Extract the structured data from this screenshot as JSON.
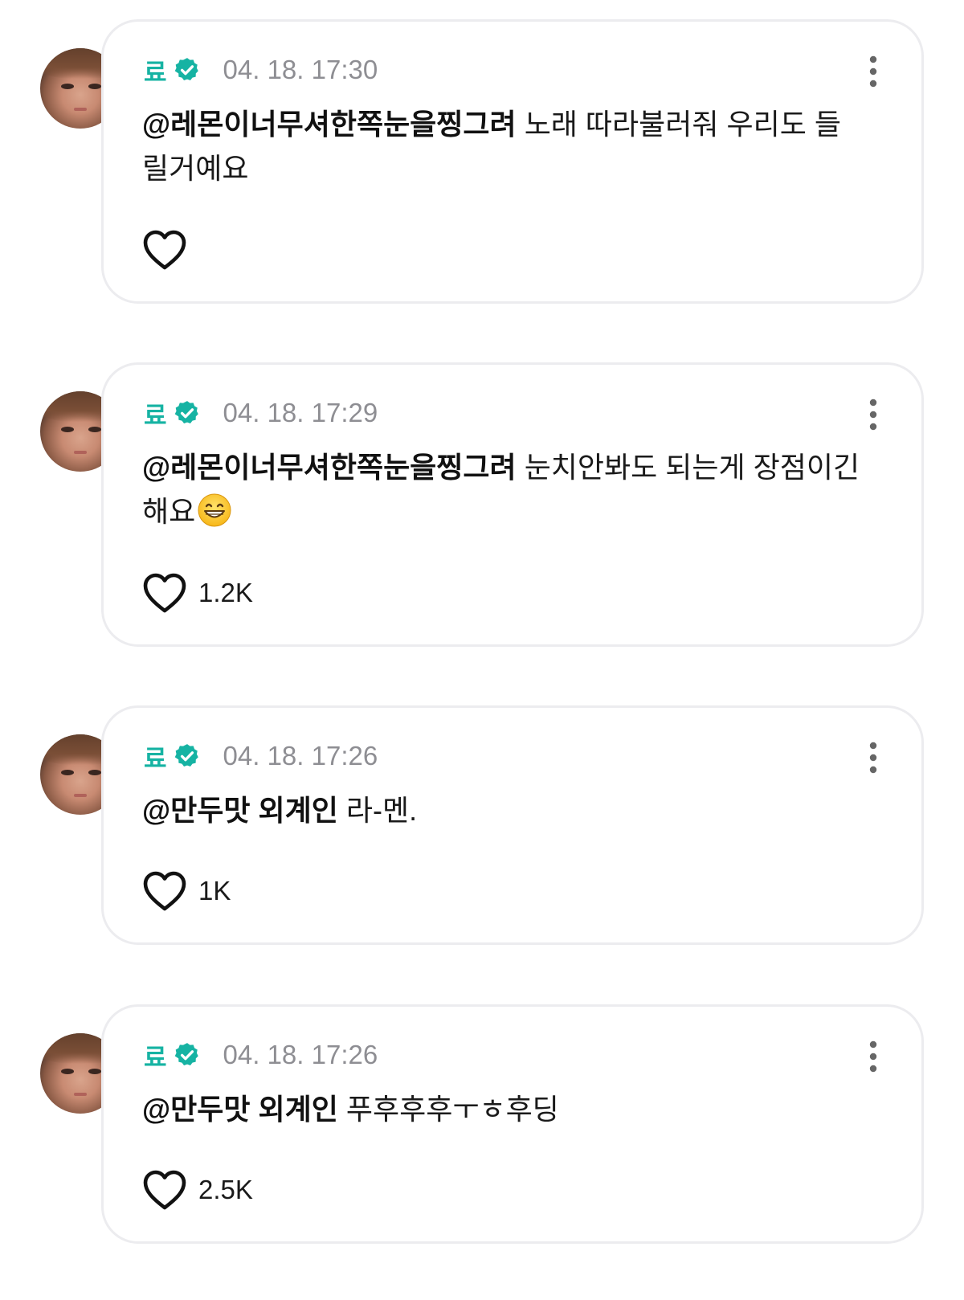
{
  "comments": [
    {
      "username": "료",
      "timestamp": "04. 18. 17:30",
      "mention": "@레몬이너무셔한쪽눈을찡그려",
      "text": "노래 따라불러줘 우리도 들릴거예요",
      "likes": ""
    },
    {
      "username": "료",
      "timestamp": "04. 18. 17:29",
      "mention": "@레몬이너무셔한쪽눈을찡그려",
      "text": "눈치안봐도 되는게 장점이긴해요",
      "emoji": "grinning-face-emoji",
      "likes": "1.2K"
    },
    {
      "username": "료",
      "timestamp": "04. 18. 17:26",
      "mention": "@만두맛 외계인",
      "text": "라-멘.",
      "likes": "1K"
    },
    {
      "username": "료",
      "timestamp": "04. 18. 17:26",
      "mention": "@만두맛 외계인",
      "text": "푸후후후ㅜㅎ후딩",
      "likes": "2.5K"
    }
  ],
  "icons": {
    "verified": "verified-badge-icon",
    "more": "more-vertical-icon",
    "like": "heart-outline-icon"
  },
  "colors": {
    "username": "#16b3a3",
    "verified_badge": "#16b3a3",
    "timestamp": "#8e8e93",
    "card_border": "#ececef"
  }
}
